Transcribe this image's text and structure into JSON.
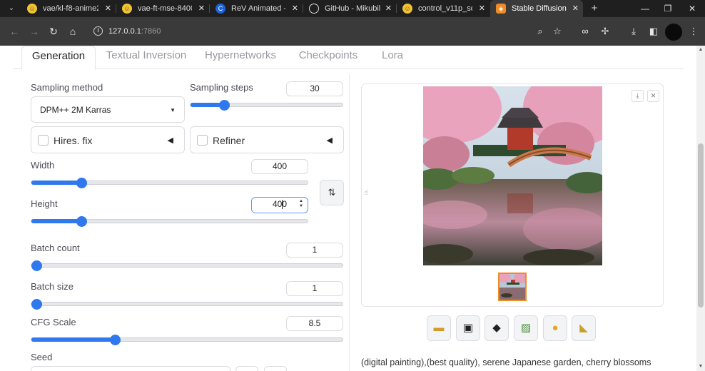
{
  "browser": {
    "tabs": [
      {
        "title": "vae/kl-f8-anime2.c",
        "icon": "huggingface-icon"
      },
      {
        "title": "vae-ft-mse-84000",
        "icon": "huggingface-icon"
      },
      {
        "title": "ReV Animated - v",
        "icon": "civitai-icon"
      },
      {
        "title": "GitHub - Mikubill/",
        "icon": "github-icon"
      },
      {
        "title": "control_v11p_sd1:",
        "icon": "huggingface-icon"
      },
      {
        "title": "Stable Diffusion",
        "icon": "stable-diffusion-icon",
        "active": true
      }
    ],
    "url_host": "127.0.0.1",
    "url_port": ":7860"
  },
  "tabs": [
    "Generation",
    "Textual Inversion",
    "Hypernetworks",
    "Checkpoints",
    "Lora"
  ],
  "left": {
    "sampling_method_label": "Sampling method",
    "sampling_method_value": "DPM++ 2M Karras",
    "sampling_steps_label": "Sampling steps",
    "sampling_steps_value": "30",
    "hires_label": "Hires. fix",
    "refiner_label": "Refiner",
    "width_label": "Width",
    "width_value": "400",
    "height_label": "Height",
    "height_value": "400",
    "batch_count_label": "Batch count",
    "batch_count_value": "1",
    "batch_size_label": "Batch size",
    "batch_size_value": "1",
    "cfg_label": "CFG Scale",
    "cfg_value": "8.5",
    "seed_label": "Seed"
  },
  "right": {
    "action_icons": [
      "folder-icon",
      "save-icon",
      "zip-icon",
      "image-icon",
      "palette-icon",
      "ruler-icon"
    ],
    "prompt_preview": "(digital painting),(best quality), serene Japanese garden, cherry blossoms"
  },
  "colors": {
    "accent": "#2f78ee",
    "thumb_border": "#f08a24"
  }
}
